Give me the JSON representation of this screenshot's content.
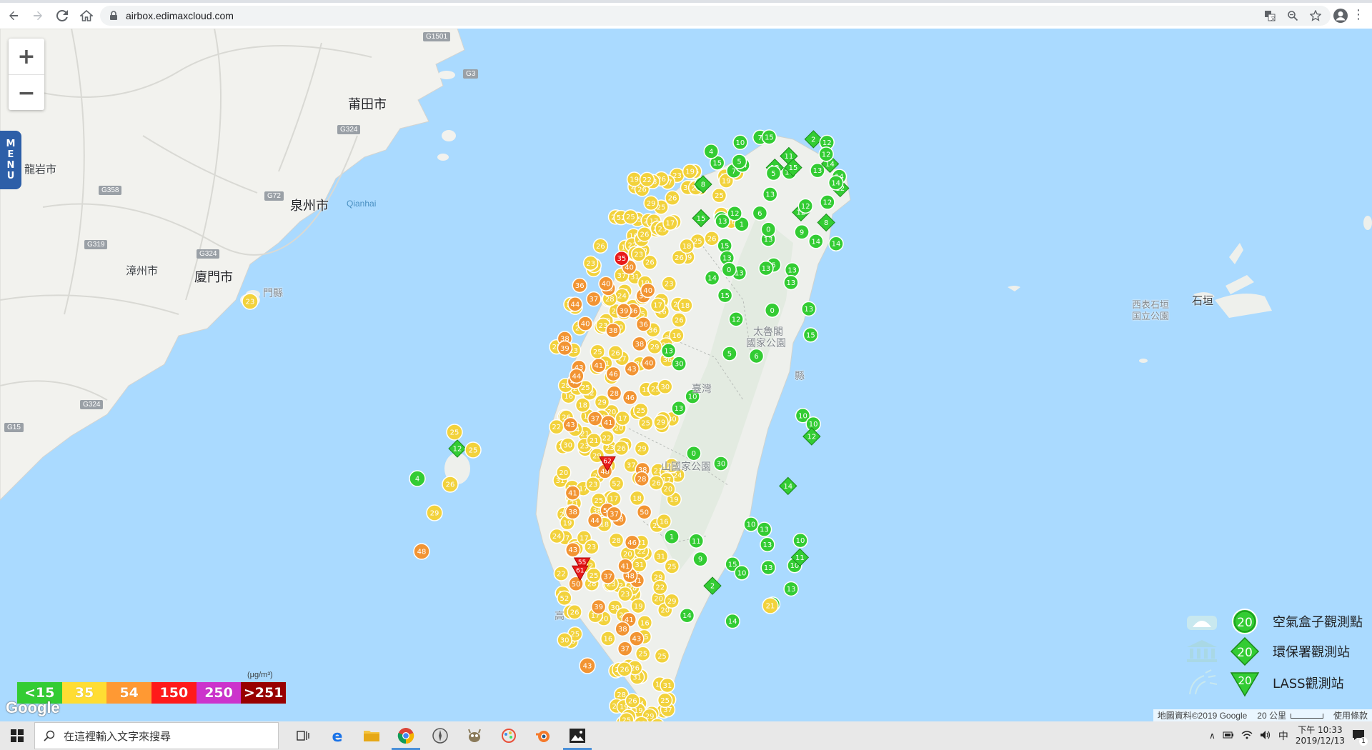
{
  "browser": {
    "url": "airbox.edimaxcloud.com",
    "icons": [
      "back-icon",
      "forward-icon",
      "reload-icon",
      "home-icon",
      "lock-icon",
      "translate-icon",
      "zoom-icon",
      "star-icon",
      "profile-icon",
      "kebab-menu-icon"
    ]
  },
  "map": {
    "menu_letters": [
      "M",
      "E",
      "N",
      "U"
    ],
    "zoom_in": "+",
    "zoom_out": "−",
    "place_labels": {
      "putian": "莆田市",
      "quanzhou": "泉州市",
      "quanzhou_en": "Qianhai",
      "longyan": "龍岩市",
      "zhangzhou": "漳州市",
      "xiamen": "廈門市",
      "kinmen": "門縣",
      "taroko": "太魯閣",
      "taroko2": "國家公園",
      "taiwan": "臺灣",
      "yushan": "山國家公園",
      "gaoxiong": "高",
      "hualien": "縣",
      "ishigaki": "石垣",
      "ishigaki_park": "西表石垣",
      "ishigaki_park2": "国立公園"
    },
    "road_shields": [
      "G1501",
      "G3",
      "G324",
      "G358",
      "G72",
      "G319",
      "G324",
      "G324",
      "G15"
    ],
    "unit": "(μg/m³)",
    "scale": [
      {
        "label": "<15",
        "color": "#33cc33"
      },
      {
        "label": "35",
        "color": "#ffdd33"
      },
      {
        "label": "54",
        "color": "#ff9933"
      },
      {
        "label": "150",
        "color": "#ff1a1a"
      },
      {
        "label": "250",
        "color": "#cc33cc"
      },
      {
        "label": ">251",
        "color": "#990000"
      }
    ],
    "google": "Google",
    "legend": [
      {
        "value": "20",
        "label": "空氣盒子觀測點",
        "icon": "airbox-icon"
      },
      {
        "value": "20",
        "label": "環保署觀測站",
        "icon": "epa-building-icon"
      },
      {
        "value": "20",
        "label": "LASS觀測站",
        "icon": "lass-icon"
      }
    ],
    "footer": {
      "attribution": "地圖資料©2019 Google",
      "scale": "20 公里",
      "terms": "使用條款"
    },
    "stations": {
      "green": [
        "12",
        "10",
        "10",
        "13",
        "11",
        "15",
        "2",
        "14",
        "1",
        "10",
        "12",
        "7",
        "11",
        "13",
        "13",
        "14",
        "9",
        "13",
        "12",
        "10",
        "5",
        "6",
        "0",
        "13",
        "14",
        "30",
        "12",
        "15",
        "10",
        "5",
        "8",
        "14",
        "15",
        "13",
        "0",
        "13",
        "15",
        "14",
        "13",
        "4",
        "12"
      ],
      "yellow": [
        "23",
        "16",
        "22",
        "19",
        "25",
        "36",
        "17",
        "19",
        "25",
        "52",
        "37",
        "28",
        "30",
        "31",
        "29",
        "26",
        "28",
        "25",
        "19",
        "29",
        "20",
        "24",
        "21",
        "18",
        "17",
        "18",
        "30",
        "26",
        "22",
        "24",
        "23",
        "16",
        "19",
        "25",
        "22",
        "20",
        "17",
        "28",
        "31",
        "25",
        "21",
        "22",
        "26",
        "23",
        "29",
        "26",
        "23",
        "17",
        "25",
        "24",
        "26",
        "29",
        "25",
        "20",
        "26",
        "23",
        "16",
        "25",
        "20",
        "25",
        "18",
        "19",
        "23"
      ],
      "orange": [
        "40",
        "43",
        "37",
        "36",
        "41",
        "48",
        "43",
        "50",
        "38",
        "40",
        "28",
        "46",
        "44",
        "41",
        "39",
        "37",
        "38"
      ],
      "red": [
        "55",
        "62",
        "61",
        "35"
      ],
      "big_markers": [
        "25",
        "12",
        "25",
        "23",
        "26",
        "29",
        "4",
        "48",
        "43",
        "21"
      ]
    }
  },
  "taskbar": {
    "search_placeholder": "在這裡輸入文字來搜尋",
    "ime": "中",
    "time": "下午 10:33",
    "date": "2019/12/13",
    "notification_count": "1"
  }
}
